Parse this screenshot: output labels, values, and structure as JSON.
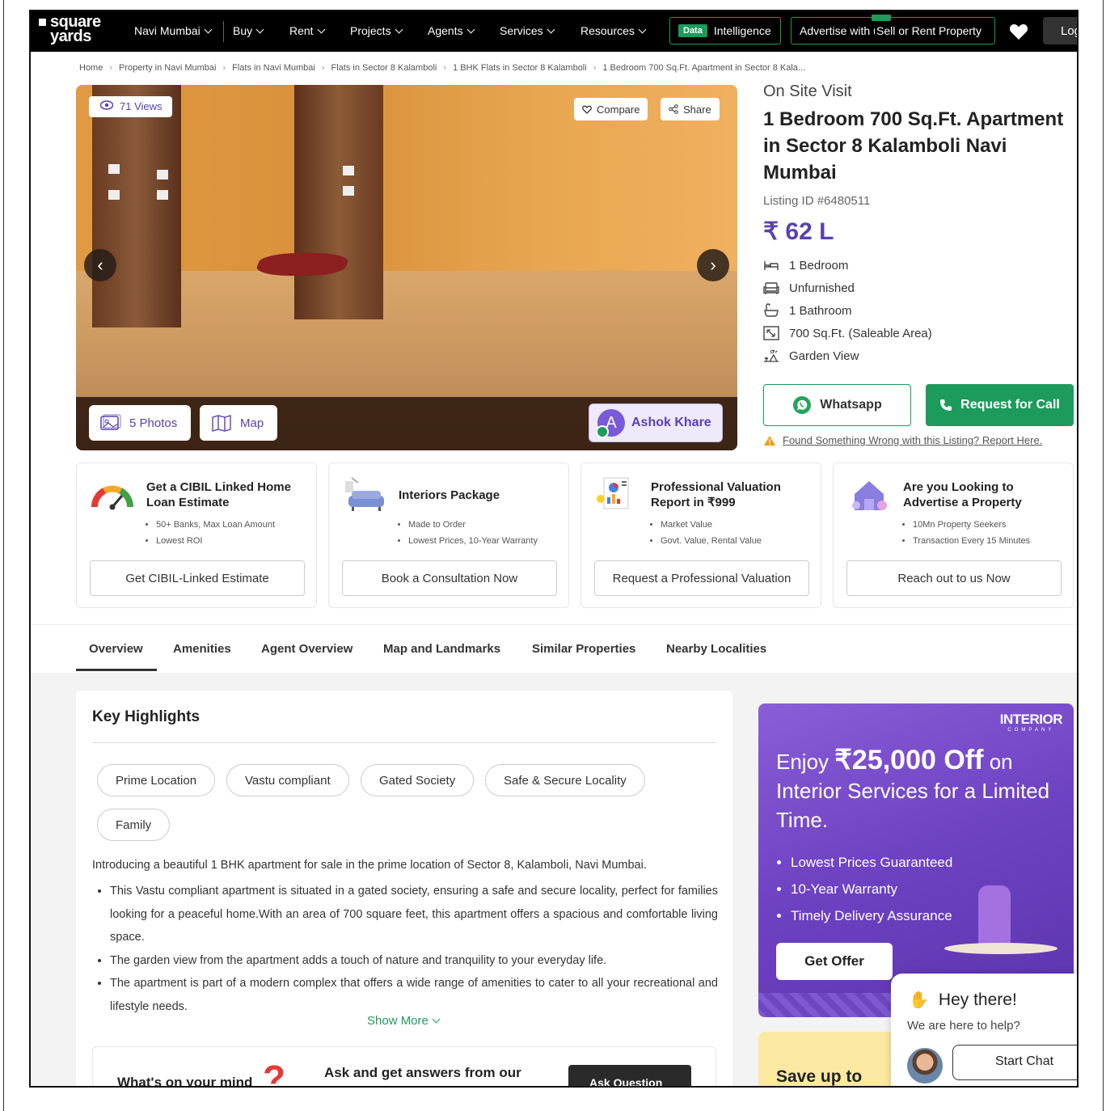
{
  "nav": {
    "logo_line1": "square",
    "logo_line2": "yards",
    "city": "Navi Mumbai",
    "items": [
      "Buy",
      "Rent",
      "Projects",
      "Agents",
      "Services",
      "Resources"
    ],
    "data_chip": "Data",
    "intelligence": "Intelligence",
    "advertise": "Advertise with us",
    "sell_rent": "Sell or Rent Property",
    "login": "Log"
  },
  "breadcrumbs": [
    "Home",
    "Property in Navi Mumbai",
    "Flats in Navi Mumbai",
    "Flats in Sector 8 Kalamboli",
    "1 BHK Flats in Sector 8 Kalamboli",
    "1 Bedroom 700 Sq.Ft. Apartment in Sector 8 Kala..."
  ],
  "gallery": {
    "views": "71 Views",
    "compare": "Compare",
    "share": "Share",
    "photos": "5 Photos",
    "map": "Map",
    "agent_initial": "A",
    "agent_name": "Ashok Khare"
  },
  "property": {
    "visit": "On Site Visit",
    "title": "1 Bedroom 700 Sq.Ft. Apartment in Sector 8 Kalamboli Navi Mumbai",
    "listing_id": "Listing ID #6480511",
    "price": "₹ 62 L",
    "features": [
      "1 Bedroom",
      "Unfurnished",
      "1 Bathroom",
      "700 Sq.Ft. (Saleable Area)",
      "Garden View"
    ],
    "whatsapp": "Whatsapp",
    "call": "Request for Call",
    "report": "Found Something Wrong with this Listing? Report Here."
  },
  "cards": [
    {
      "title": "Get a CIBIL Linked Home Loan Estimate",
      "bullets": [
        "50+ Banks, Max Loan Amount",
        "Lowest ROI"
      ],
      "button": "Get CIBIL-Linked Estimate"
    },
    {
      "title": "Interiors Package",
      "bullets": [
        "Made to Order",
        "Lowest Prices, 10-Year Warranty"
      ],
      "button": "Book a Consultation Now"
    },
    {
      "title": "Professional Valuation Report in ₹999",
      "bullets": [
        "Market Value",
        "Govt. Value, Rental Value"
      ],
      "button": "Request a Professional Valuation"
    },
    {
      "title": "Are you Looking to Advertise a Property",
      "bullets": [
        "10Mn Property Seekers",
        "Transaction Every 15 Minutes"
      ],
      "button": "Reach out to us Now"
    }
  ],
  "tabs": [
    "Overview",
    "Amenities",
    "Agent Overview",
    "Map and Landmarks",
    "Similar Properties",
    "Nearby Localities"
  ],
  "highlights": {
    "title": "Key Highlights",
    "tags": [
      "Prime Location",
      "Vastu compliant",
      "Gated Society",
      "Safe & Secure Locality",
      "Family"
    ],
    "intro": "Introducing a beautiful 1 BHK apartment for sale in the prime location of Sector 8, Kalamboli, Navi Mumbai.",
    "points": [
      "This Vastu compliant apartment is situated in a gated society, ensuring a safe and secure locality, perfect for families looking for a peaceful home.With an area of 700 square feet, this apartment offers a spacious and comfortable living space.",
      "The garden view from the apartment adds a touch of nature and tranquility to your everyday life.",
      "The apartment is part of a modern complex that offers a wide range of amenities to cater to all your recreational and lifestyle needs."
    ],
    "show_more": "Show More"
  },
  "ask": {
    "question": "What's on your mind",
    "mark": "?",
    "text": "Ask and get answers from our",
    "button": "Ask Question"
  },
  "promo": {
    "brand": "INTERIOR",
    "brand_sub": "COMPANY",
    "enjoy": "Enjoy",
    "amount": "₹25,000 Off",
    "rest": "on Interior Services for a Limited Time.",
    "bullets": [
      "Lowest Prices Guaranteed",
      "10-Year Warranty",
      "Timely Delivery Assurance"
    ],
    "button": "Get Offer",
    "save": "Save up to"
  },
  "chat": {
    "hello": "Hey there!",
    "sub": "We are here to help?",
    "button": "Start Chat"
  },
  "colors": {
    "brand_purple": "#5a3fb5",
    "green": "#1d9b5c",
    "nav_bg": "#000000"
  }
}
